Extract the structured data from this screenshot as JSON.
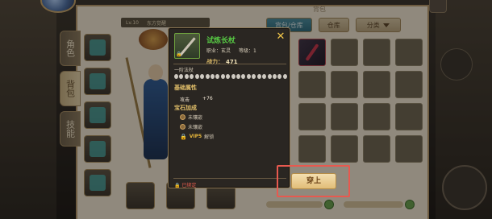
{
  "panel": {
    "title": "背包"
  },
  "side_tabs": [
    "角色",
    "背包",
    "技能"
  ],
  "level_strip": {
    "level": "Lv.10",
    "name": "东方觉醒"
  },
  "topbar": {
    "tab_bag": "背包/仓库",
    "tab_store": "仓库",
    "filter": "分类"
  },
  "tooltip": {
    "name": "试炼长杖",
    "class_label": "职业：玄灵",
    "level_label": "等级：1",
    "power_label": "战力：",
    "power_value": "471",
    "tier": "一阶法杖",
    "enhance_pips_filled": 0,
    "enhance_pips_total": 22,
    "base_heading": "基础属性",
    "attr_name": "攻击",
    "attr_value": "+76",
    "gem_heading": "宝石加成",
    "gem_slot_1": "未镶嵌",
    "gem_slot_2": "未镶嵌",
    "gem_vip_tag": "VIP5",
    "gem_vip_text": "解锁",
    "bound": "已绑定",
    "close_icon": "close-icon"
  },
  "wear_button": {
    "label": "穿上"
  },
  "colors": {
    "item_name": "#57c944",
    "power": "#e3c06a",
    "bound": "#e05a4c",
    "highlight": "#e7594f"
  }
}
